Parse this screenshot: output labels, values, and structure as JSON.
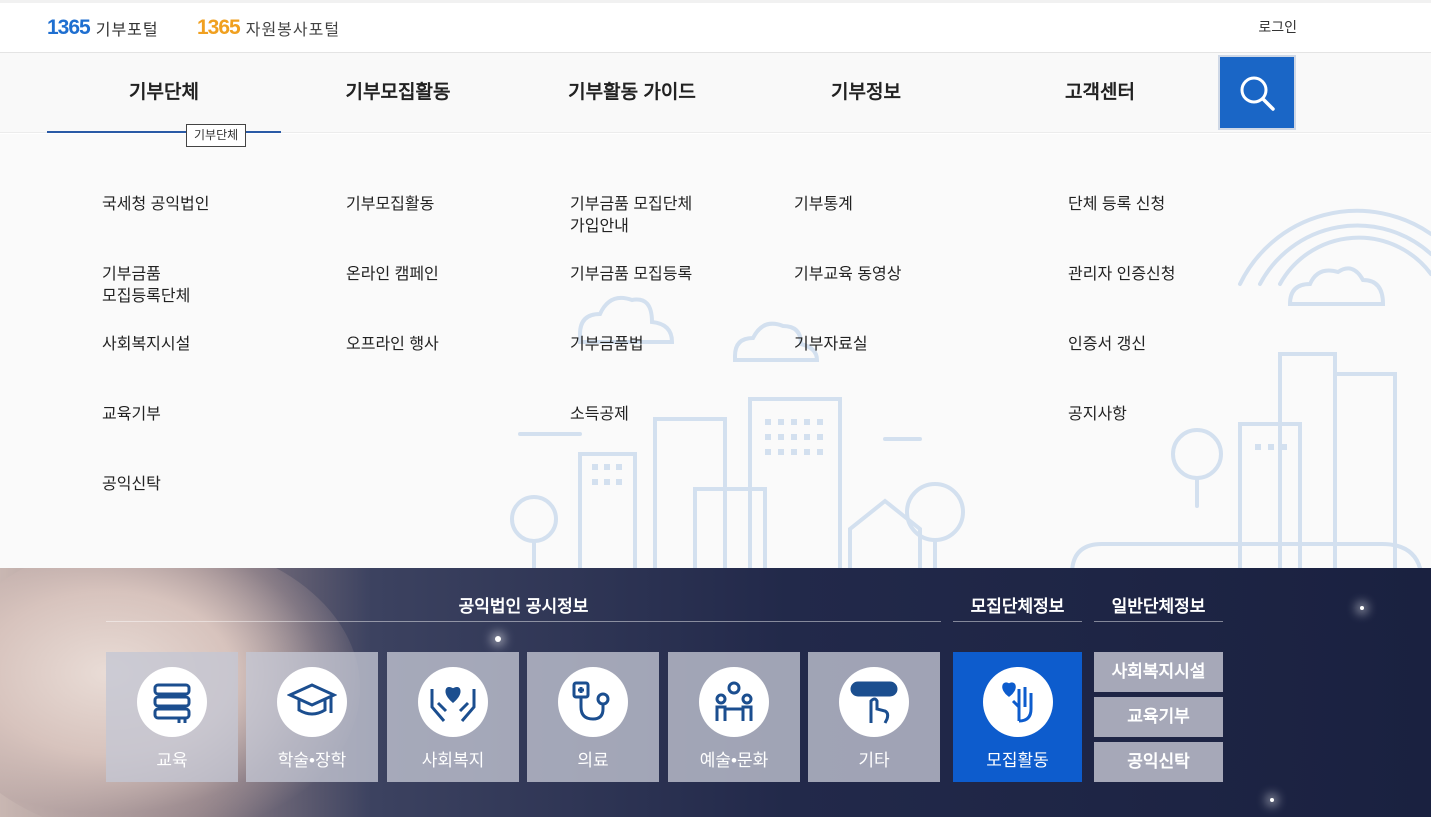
{
  "header": {
    "logo1": {
      "num": "1365",
      "text": "기부포털"
    },
    "logo2": {
      "num": "1365",
      "text": "자원봉사포털"
    },
    "login": "로그인"
  },
  "nav": {
    "items": [
      "기부단체",
      "기부모집활동",
      "기부활동 가이드",
      "기부정보",
      "고객센터"
    ],
    "tooltip": "기부단체",
    "search_icon": "search-icon"
  },
  "mega": {
    "col1": [
      "국세청 공익법인",
      "기부금품\n모집등록단체",
      "사회복지시설",
      "교육기부",
      "공익신탁"
    ],
    "col2": [
      "기부모집활동",
      "온라인 캠페인",
      "오프라인 행사"
    ],
    "col3": [
      "기부금품 모집단체\n가입안내",
      "기부금품 모집등록",
      "기부금품법",
      "소득공제"
    ],
    "col4": [
      "기부통계",
      "기부교육 동영상",
      "기부자료실"
    ],
    "col5": [
      "단체 등록 신청",
      "관리자 인증신청",
      "인증서 갱신",
      "공지사항"
    ]
  },
  "bottom": {
    "heading1": "공익법인 공시정보",
    "heading2": "모집단체정보",
    "heading3": "일반단체정보",
    "tiles": [
      {
        "label": "교육",
        "icon": "books-icon"
      },
      {
        "label": "학술•장학",
        "icon": "graduation-cap-icon"
      },
      {
        "label": "사회복지",
        "icon": "hands-heart-icon"
      },
      {
        "label": "의료",
        "icon": "stethoscope-icon"
      },
      {
        "label": "예술•문화",
        "icon": "people-globe-icon"
      },
      {
        "label": "기타",
        "icon": "donate-button-icon"
      }
    ],
    "recruit_tile": {
      "label": "모집활동",
      "icon": "hand-heart-icon"
    },
    "side_buttons": [
      "사회복지시설",
      "교육기부",
      "공익신탁"
    ]
  },
  "colors": {
    "accent": "#1a66c6",
    "recruit": "#0d5ccd",
    "nav_line": "#2a5aa6"
  }
}
